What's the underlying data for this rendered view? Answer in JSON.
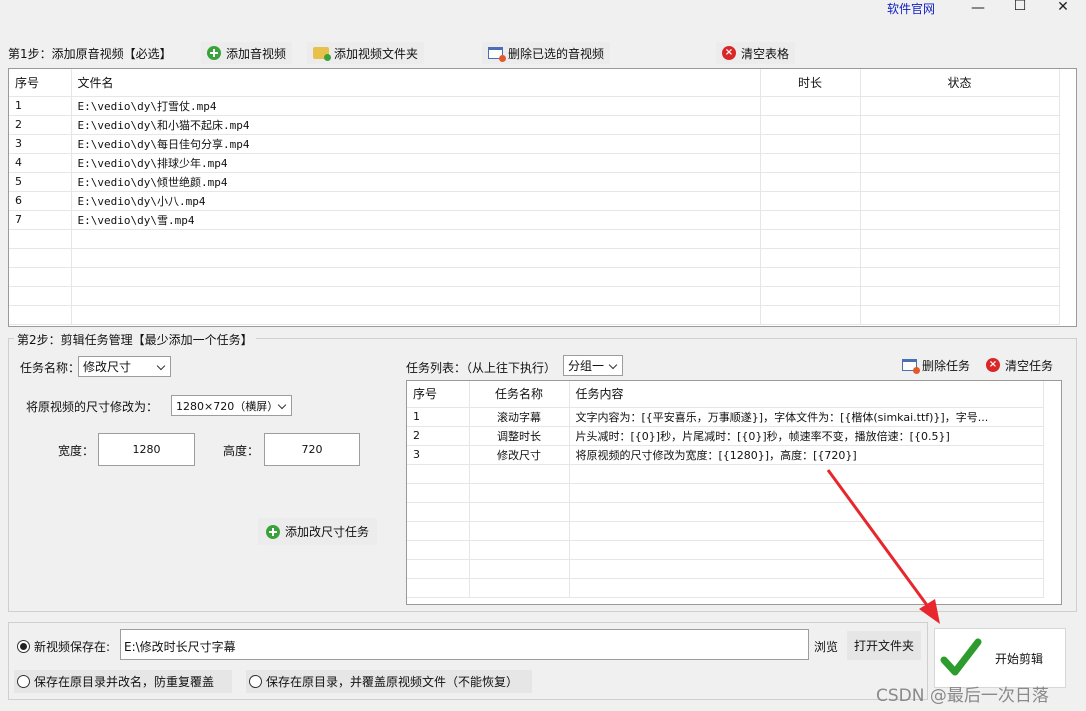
{
  "titlebar": {
    "official_site_link": "软件官网",
    "minimize_glyph": "—",
    "maximize_glyph": "☐",
    "close_glyph": "✕"
  },
  "step1": {
    "label": "第1步：添加原音视频【必选】",
    "add_audio_video": "添加音视频",
    "add_video_folder": "添加视频文件夹",
    "delete_selected": "删除已选的音视频",
    "clear_table": "清空表格",
    "table": {
      "columns": [
        "序号",
        "文件名",
        "时长",
        "状态"
      ],
      "rows": [
        {
          "index": "1",
          "file": "E:\\vedio\\dy\\打雪仗.mp4",
          "duration": "",
          "status": ""
        },
        {
          "index": "2",
          "file": "E:\\vedio\\dy\\和小猫不起床.mp4",
          "duration": "",
          "status": ""
        },
        {
          "index": "3",
          "file": "E:\\vedio\\dy\\每日佳句分享.mp4",
          "duration": "",
          "status": ""
        },
        {
          "index": "4",
          "file": "E:\\vedio\\dy\\排球少年.mp4",
          "duration": "",
          "status": ""
        },
        {
          "index": "5",
          "file": "E:\\vedio\\dy\\倾世绝颜.mp4",
          "duration": "",
          "status": ""
        },
        {
          "index": "6",
          "file": "E:\\vedio\\dy\\小八.mp4",
          "duration": "",
          "status": ""
        },
        {
          "index": "7",
          "file": "E:\\vedio\\dy\\雪.mp4",
          "duration": "",
          "status": ""
        }
      ]
    }
  },
  "step2": {
    "label": "第2步：剪辑任务管理【最少添加一个任务】",
    "task_name_label": "任务名称：",
    "task_name_value": "修改尺寸",
    "resize_label": "将原视频的尺寸修改为：",
    "resize_value": "1280×720（横屏）",
    "width_label": "宽度：",
    "width_value": "1280",
    "height_label": "高度：",
    "height_value": "720",
    "add_task_button": "添加改尺寸任务",
    "task_list_label": "任务列表：（从上往下执行）",
    "group_value": "分组一",
    "delete_task": "删除任务",
    "clear_tasks": "清空任务",
    "task_table": {
      "columns": [
        "序号",
        "任务名称",
        "任务内容"
      ],
      "rows": [
        {
          "index": "1",
          "name": "滚动字幕",
          "content": "文字内容为：[{平安喜乐，万事顺遂}]，字体文件为：[{楷体(simkai.ttf)}]，字号..."
        },
        {
          "index": "2",
          "name": "调整时长",
          "content": "片头减时：[{0}]秒，片尾减时：[{0}]秒，帧速率不变，播放倍速：[{0.5}]"
        },
        {
          "index": "3",
          "name": "修改尺寸",
          "content": "将原视频的尺寸修改为宽度：[{1280}]，高度：[{720}]"
        }
      ]
    }
  },
  "output": {
    "save_new_label": "新视频保存在:",
    "save_path": "E:\\修改时长尺寸字幕",
    "browse": "浏览",
    "open_folder": "打开文件夹",
    "option_rename": "保存在原目录并改名，防重复覆盖",
    "option_overwrite": "保存在原目录，并覆盖原视频文件（不能恢复）",
    "start_button": "开始剪辑"
  },
  "watermark": "CSDN @最后一次日落",
  "colors": {
    "arrow": "#e8262e",
    "check_green": "#2e9b2e",
    "link_blue": "#1020c0"
  }
}
